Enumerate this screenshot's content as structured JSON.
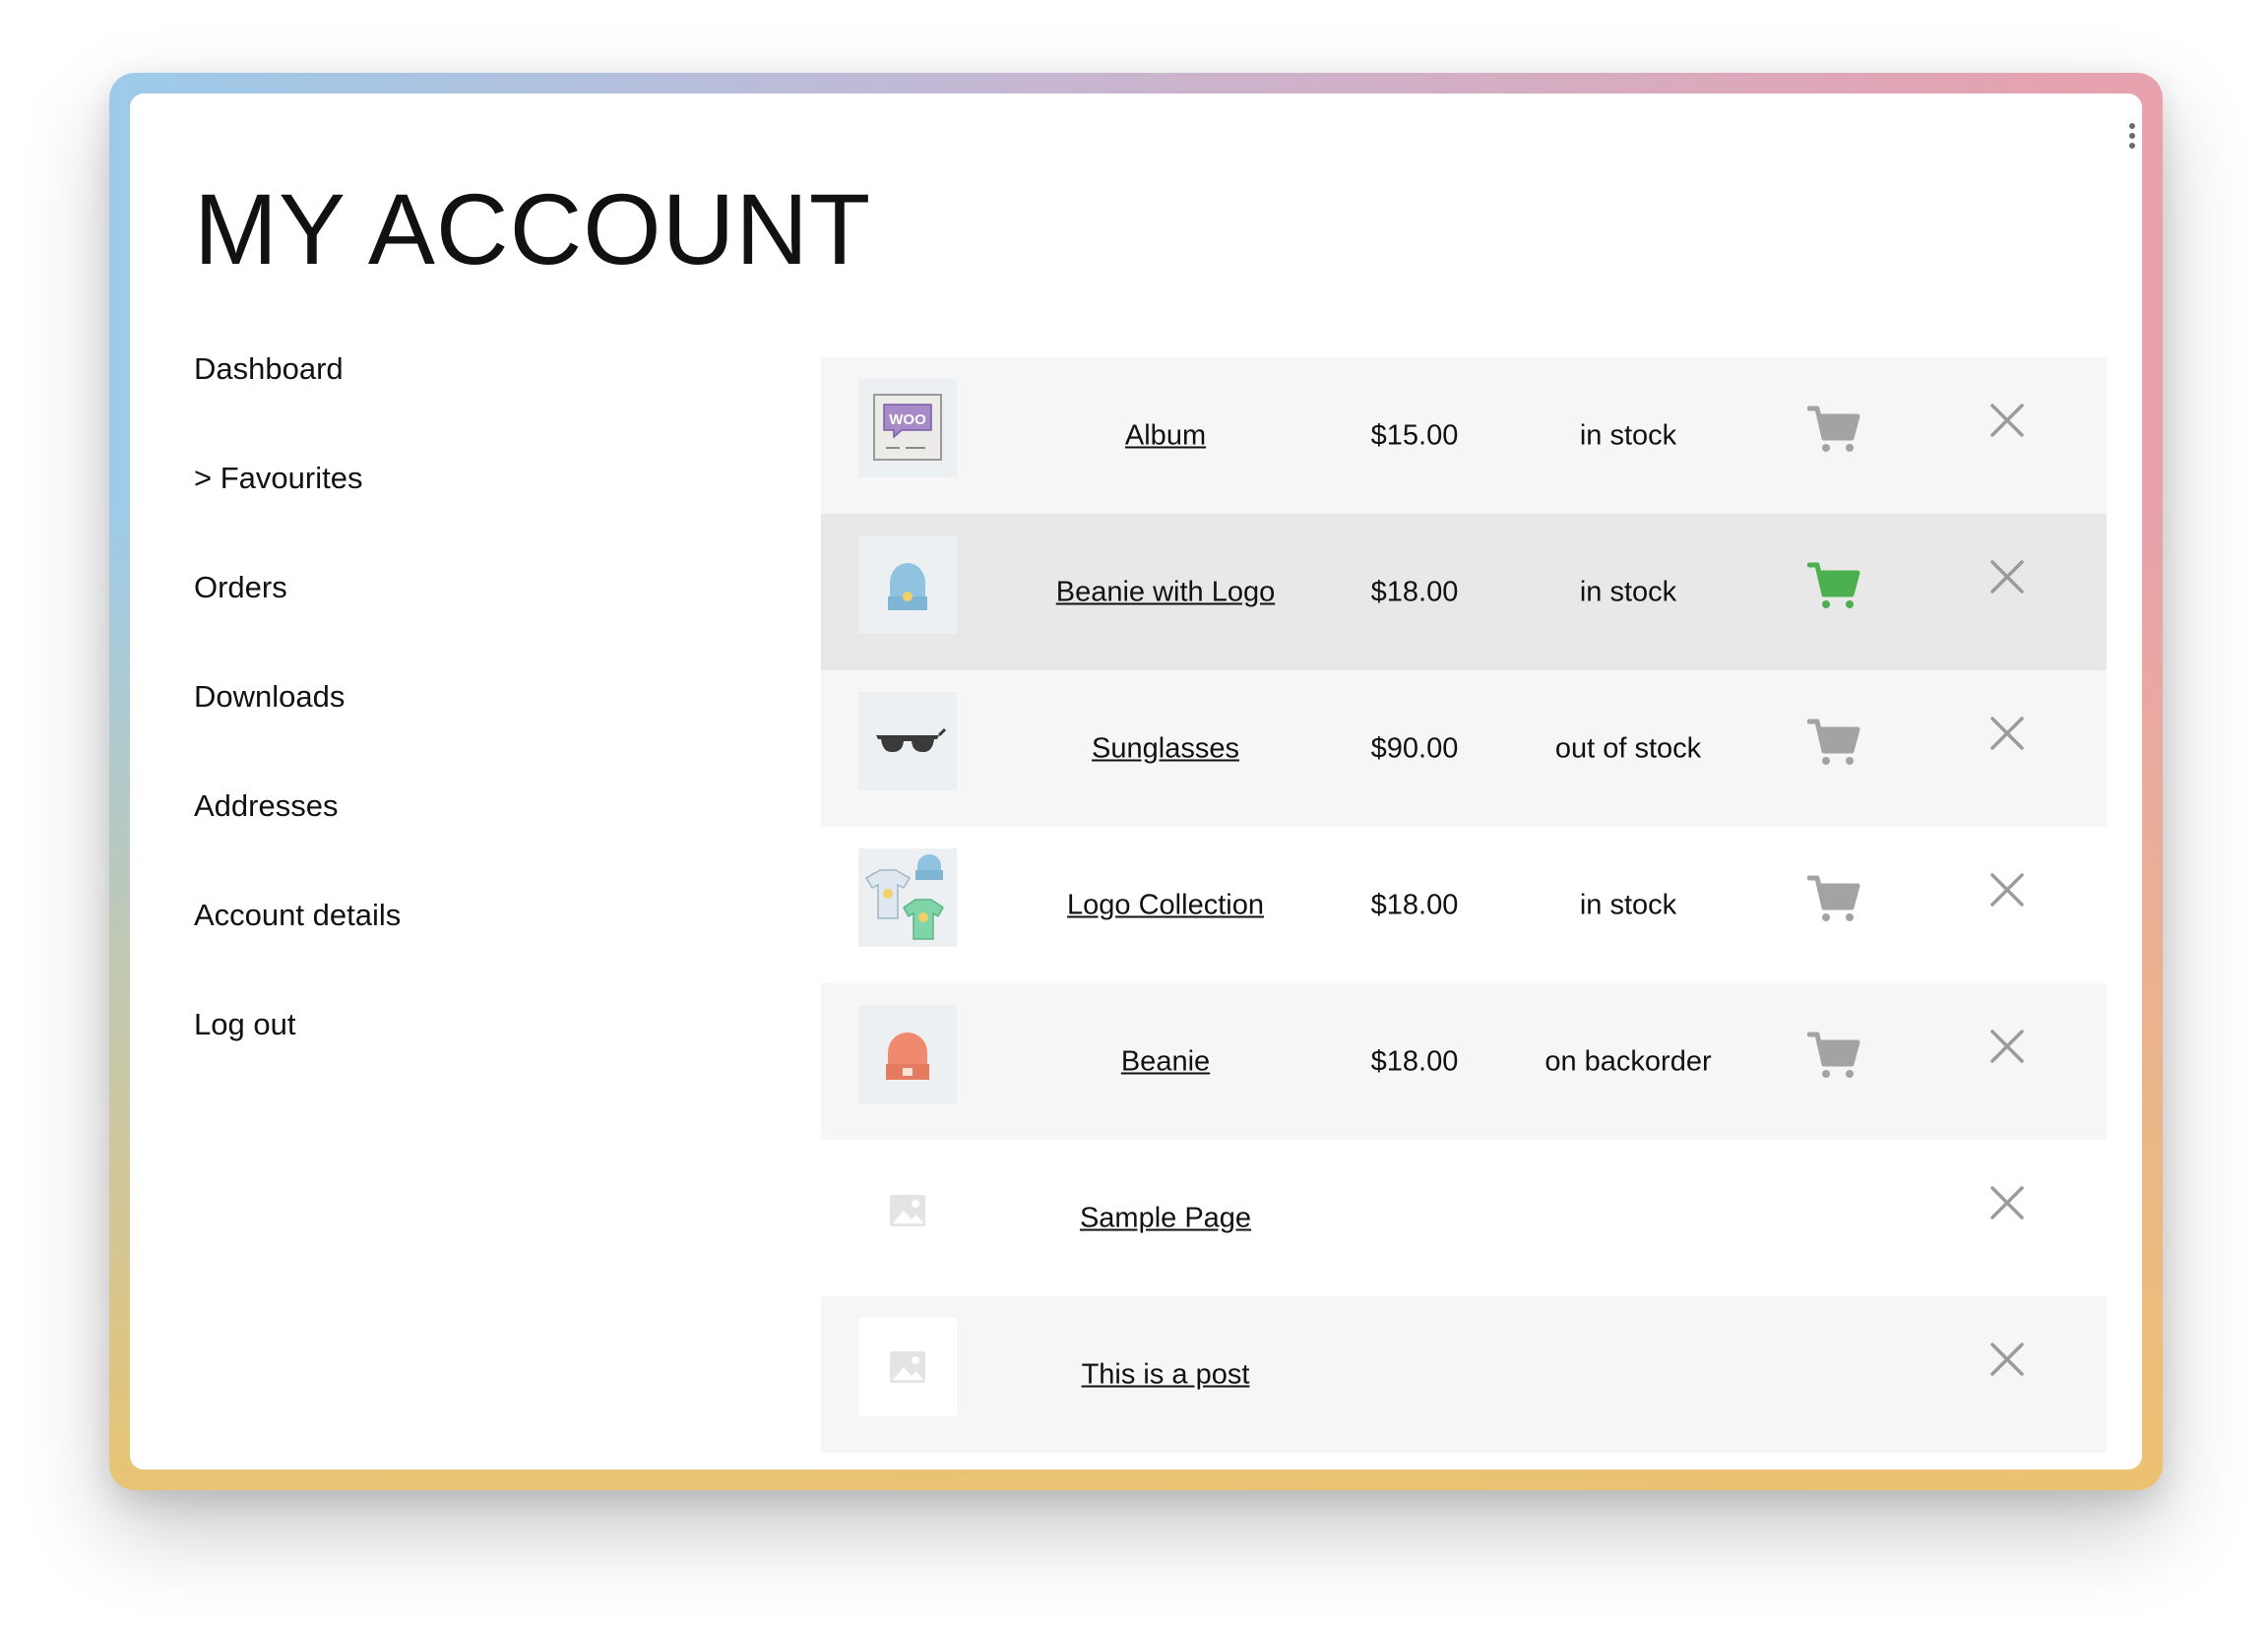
{
  "page": {
    "title": "MY ACCOUNT"
  },
  "nav": {
    "items": [
      {
        "label": "Dashboard"
      },
      {
        "label": "> Favourites"
      },
      {
        "label": "Orders"
      },
      {
        "label": "Downloads"
      },
      {
        "label": "Addresses"
      },
      {
        "label": "Account details"
      },
      {
        "label": "Log out"
      }
    ],
    "active": "> Favourites"
  },
  "favourites": {
    "rows": [
      {
        "name": "Album",
        "price": "$15.00",
        "stock": "in stock",
        "thumb_icon": "album-woo-icon",
        "has_cart": true
      },
      {
        "name": "Beanie with Logo",
        "price": "$18.00",
        "stock": "in stock",
        "thumb_icon": "blue-beanie-icon",
        "has_cart": true,
        "hovered": true
      },
      {
        "name": "Sunglasses",
        "price": "$90.00",
        "stock": "out of stock",
        "thumb_icon": "sunglasses-icon",
        "has_cart": true
      },
      {
        "name": "Logo Collection",
        "price": "$18.00",
        "stock": "in stock",
        "thumb_icon": "logo-collection-icon",
        "has_cart": true
      },
      {
        "name": "Beanie",
        "price": "$18.00",
        "stock": "on backorder",
        "thumb_icon": "orange-beanie-icon",
        "has_cart": true
      },
      {
        "name": "Sample Page",
        "price": "",
        "stock": "",
        "thumb_icon": "image-placeholder-icon",
        "has_cart": false
      },
      {
        "name": "This is a post",
        "price": "",
        "stock": "",
        "thumb_icon": "image-placeholder-icon",
        "has_cart": false
      }
    ]
  },
  "colors": {
    "cart_default": "#a3a3a3",
    "cart_active": "#4caf50",
    "remove": "#9b9b9b",
    "row_alt": "#f6f6f6",
    "row_hover": "#e8e8e8"
  }
}
